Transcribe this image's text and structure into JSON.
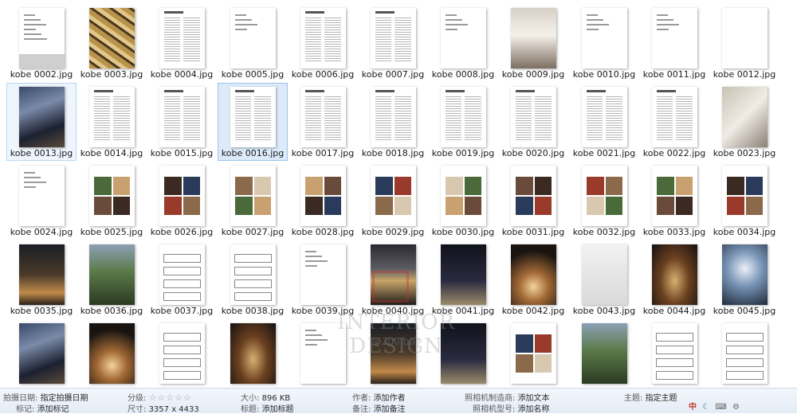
{
  "files": [
    "kobe 0002.jpg",
    "kobe 0003.jpg",
    "kobe 0004.jpg",
    "kobe 0005.jpg",
    "kobe 0006.jpg",
    "kobe 0007.jpg",
    "kobe 0008.jpg",
    "kobe 0009.jpg",
    "kobe 0010.jpg",
    "kobe 0011.jpg",
    "kobe 0012.jpg",
    "kobe 0013.jpg",
    "kobe 0014.jpg",
    "kobe 0015.jpg",
    "kobe 0016.jpg",
    "kobe 0017.jpg",
    "kobe 0018.jpg",
    "kobe 0019.jpg",
    "kobe 0020.jpg",
    "kobe 0021.jpg",
    "kobe 0022.jpg",
    "kobe 0023.jpg",
    "kobe 0024.jpg",
    "kobe 0025.jpg",
    "kobe 0026.jpg",
    "kobe 0027.jpg",
    "kobe 0028.jpg",
    "kobe 0029.jpg",
    "kobe 0030.jpg",
    "kobe 0031.jpg",
    "kobe 0032.jpg",
    "kobe 0033.jpg",
    "kobe 0034.jpg",
    "kobe 0035.jpg",
    "kobe 0036.jpg",
    "kobe 0037.jpg",
    "kobe 0038.jpg",
    "kobe 0039.jpg",
    "kobe 0040.jpg",
    "kobe 0041.jpg",
    "kobe 0042.jpg",
    "kobe 0043.jpg",
    "kobe 0044.jpg",
    "kobe 0045.jpg",
    "",
    "",
    "",
    "",
    "",
    "",
    "",
    "",
    "",
    "",
    ""
  ],
  "selected_files": [
    "kobe 0013.jpg",
    "kobe 0016.jpg"
  ],
  "watermark": {
    "title": "INTERIOR DESIGN",
    "subtitle": "@200 bbs"
  },
  "details": {
    "date_taken_label": "拍摄日期:",
    "date_taken_value": "指定拍摄日期",
    "tags_label": "标记:",
    "tags_value": "添加标记",
    "rating_label": "分级:",
    "rating_stars": "☆☆☆☆☆",
    "dimensions_label": "尺寸:",
    "dimensions_value": "3357 x 4433",
    "size_label": "大小:",
    "size_value": "896 KB",
    "title_label": "标题:",
    "title_value": "添加标题",
    "author_label": "作者:",
    "author_value": "添加作者",
    "comments_label": "备注:",
    "comments_value": "添加备注",
    "camera_maker_label": "照相机制造商:",
    "camera_maker_value": "添加文本",
    "camera_model_label": "照相机型号:",
    "camera_model_value": "添加名称",
    "subject_label": "主题:",
    "subject_value": "指定主题"
  },
  "tray": {
    "ime_label": "中",
    "icons": [
      "moon-icon",
      "keyboard-icon",
      "settings-icon"
    ]
  },
  "colors": {
    "selected_bg": "#dceafa",
    "selected_border": "#9cc3ea",
    "details_bg": "#e4ecf6"
  }
}
